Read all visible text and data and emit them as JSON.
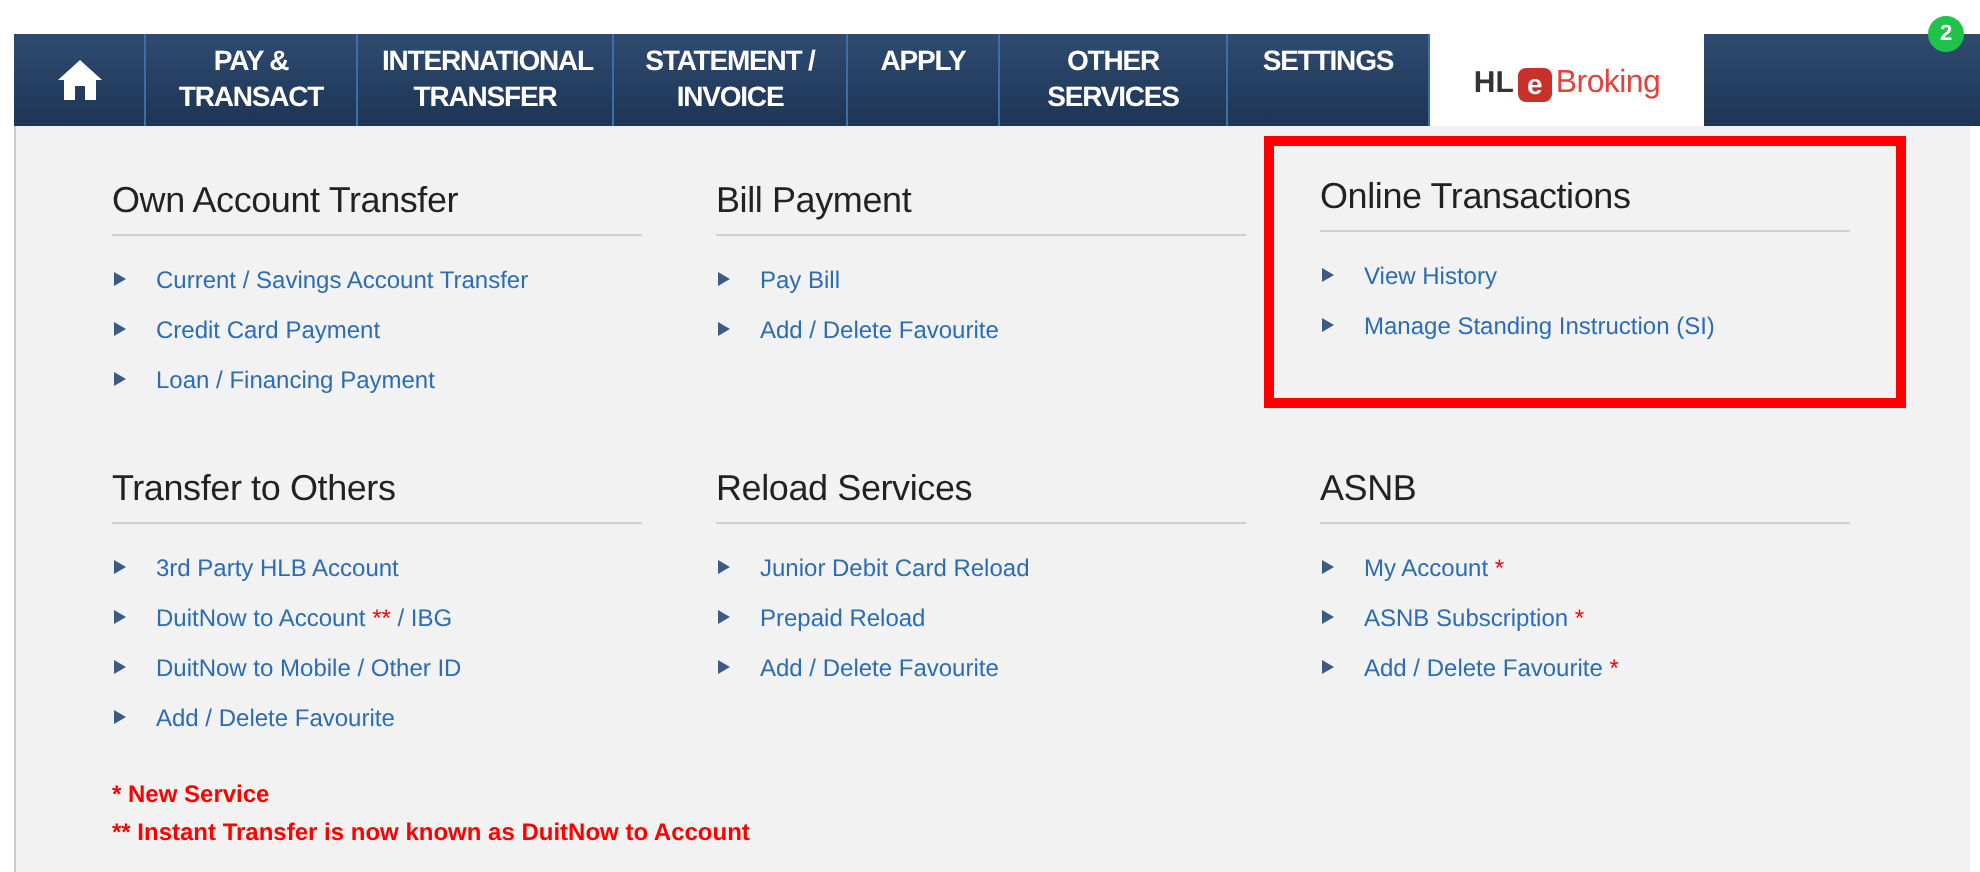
{
  "nav": {
    "tabs": [
      {
        "kind": "home",
        "selected": false
      },
      {
        "kind": "text",
        "label": "PAY &\nTRANSACT",
        "selected": false
      },
      {
        "kind": "text",
        "label": "INTERNATIONAL\nTRANSFER",
        "selected": false
      },
      {
        "kind": "text",
        "label": "STATEMENT /\nINVOICE",
        "selected": false
      },
      {
        "kind": "text",
        "label": "APPLY",
        "selected": false
      },
      {
        "kind": "text",
        "label": "OTHER\nSERVICES",
        "selected": false
      },
      {
        "kind": "text",
        "label": "SETTINGS",
        "selected": false
      },
      {
        "kind": "logo",
        "prefix": "HL",
        "cube": "e",
        "suffix": "Broking",
        "selected": true
      }
    ],
    "badge": "2"
  },
  "sections": [
    {
      "title": "Own Account Transfer",
      "highlighted": false,
      "links": [
        {
          "label": "Current / Savings Account Transfer"
        },
        {
          "label": "Credit Card Payment"
        },
        {
          "label": "Loan / Financing Payment"
        }
      ]
    },
    {
      "title": "Bill Payment",
      "highlighted": false,
      "links": [
        {
          "label": "Pay Bill"
        },
        {
          "label": "Add / Delete Favourite"
        }
      ]
    },
    {
      "title": "Online Transactions",
      "highlighted": true,
      "links": [
        {
          "label": "View History"
        },
        {
          "label": "Manage Standing Instruction (SI)"
        }
      ]
    },
    {
      "title": "Transfer to Others",
      "highlighted": false,
      "links": [
        {
          "label": "3rd Party HLB Account"
        },
        {
          "label": "DuitNow to Account",
          "mark": "**",
          "after": "/ IBG"
        },
        {
          "label": "DuitNow to Mobile / Other ID"
        },
        {
          "label": "Add / Delete Favourite"
        }
      ]
    },
    {
      "title": "Reload Services",
      "highlighted": false,
      "links": [
        {
          "label": "Junior Debit Card Reload"
        },
        {
          "label": "Prepaid Reload"
        },
        {
          "label": "Add / Delete Favourite"
        }
      ]
    },
    {
      "title": "ASNB",
      "highlighted": false,
      "links": [
        {
          "label": "My Account",
          "mark": "*"
        },
        {
          "label": "ASNB Subscription",
          "mark": "*"
        },
        {
          "label": "Add / Delete Favourite",
          "mark": "*"
        }
      ]
    }
  ],
  "footnotes": [
    "* New Service",
    "** Instant Transfer is now known as DuitNow to Account"
  ]
}
